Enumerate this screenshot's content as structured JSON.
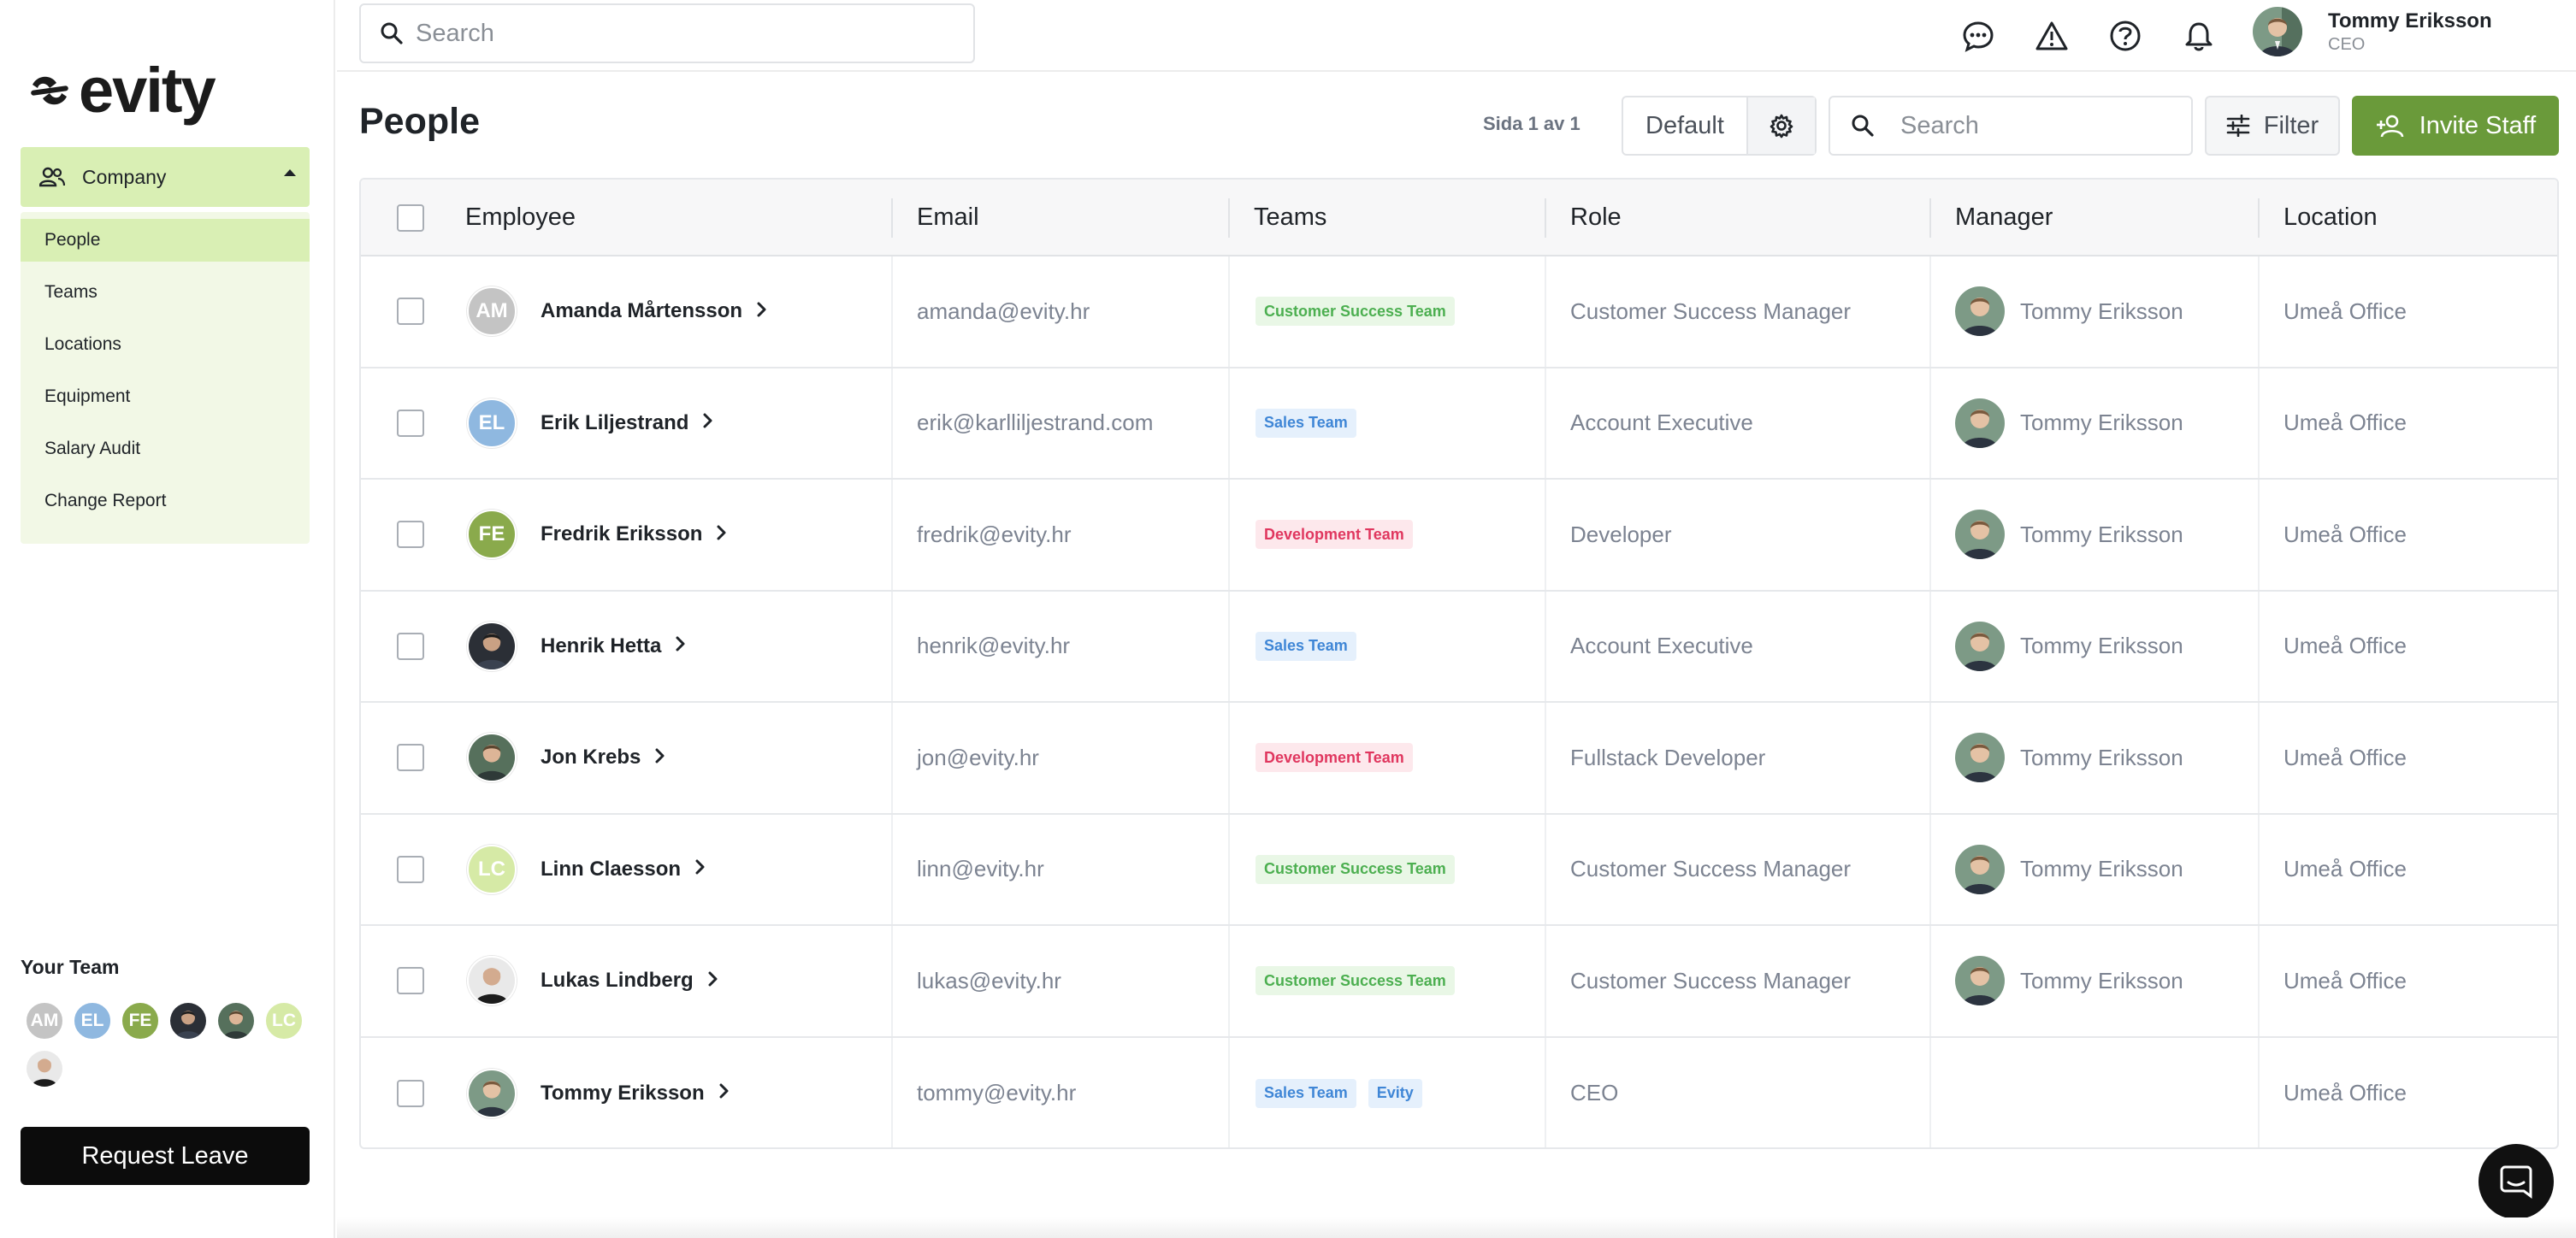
{
  "brand": {
    "logo_text": "evity",
    "accent": "#6a9a3a",
    "nav_active": "#d9efb4",
    "nav_bg": "#f2f8e6"
  },
  "topbar": {
    "search_placeholder": "Search",
    "icons": [
      "chat-icon",
      "alert-icon",
      "help-icon",
      "bell-icon"
    ],
    "user": {
      "name": "Tommy Eriksson",
      "role": "CEO"
    }
  },
  "sidebar": {
    "section_label": "Company",
    "items": [
      {
        "label": "People",
        "active": true
      },
      {
        "label": "Teams"
      },
      {
        "label": "Locations"
      },
      {
        "label": "Equipment"
      },
      {
        "label": "Salary Audit"
      },
      {
        "label": "Change Report"
      }
    ],
    "your_team_label": "Your Team",
    "team_members": [
      {
        "initials": "AM",
        "color": "#c4c4c4"
      },
      {
        "initials": "EL",
        "color": "#8fb8e0"
      },
      {
        "initials": "FE",
        "color": "#8aaa4c"
      },
      {
        "initials": "",
        "photo": "dark"
      },
      {
        "initials": "",
        "photo": "green"
      },
      {
        "initials": "LC",
        "color": "#d6eaa6"
      },
      {
        "initials": "",
        "photo": "bald"
      }
    ],
    "request_leave_label": "Request Leave"
  },
  "page": {
    "title": "People",
    "pager": "Sida 1 av 1",
    "view_label": "Default",
    "search_placeholder": "Search",
    "filter_label": "Filter",
    "invite_label": "Invite Staff"
  },
  "table": {
    "columns": [
      "Employee",
      "Email",
      "Teams",
      "Role",
      "Manager",
      "Location"
    ],
    "rows": [
      {
        "initials": "AM",
        "avatar_color": "#c4c4c4",
        "name": "Amanda Mårtensson",
        "email": "amanda@evity.hr",
        "teams": [
          {
            "label": "Customer Success Team",
            "kind": "green"
          }
        ],
        "role": "Customer Success Manager",
        "manager": "Tommy Eriksson",
        "location": "Umeå Office"
      },
      {
        "initials": "EL",
        "avatar_color": "#8fb8e0",
        "name": "Erik Liljestrand",
        "email": "erik@karlliljestrand.com",
        "teams": [
          {
            "label": "Sales Team",
            "kind": "blue"
          }
        ],
        "role": "Account Executive",
        "manager": "Tommy Eriksson",
        "location": "Umeå Office"
      },
      {
        "initials": "FE",
        "avatar_color": "#8aaa4c",
        "name": "Fredrik Eriksson",
        "email": "fredrik@evity.hr",
        "teams": [
          {
            "label": "Development Team",
            "kind": "red"
          }
        ],
        "role": "Developer",
        "manager": "Tommy Eriksson",
        "location": "Umeå Office"
      },
      {
        "initials": "",
        "photo": "dark",
        "name": "Henrik Hetta",
        "email": "henrik@evity.hr",
        "teams": [
          {
            "label": "Sales Team",
            "kind": "blue"
          }
        ],
        "role": "Account Executive",
        "manager": "Tommy Eriksson",
        "location": "Umeå Office"
      },
      {
        "initials": "",
        "photo": "green",
        "name": "Jon Krebs",
        "email": "jon@evity.hr",
        "teams": [
          {
            "label": "Development Team",
            "kind": "red"
          }
        ],
        "role": "Fullstack Developer",
        "manager": "Tommy Eriksson",
        "location": "Umeå Office"
      },
      {
        "initials": "LC",
        "avatar_color": "#d6eaa6",
        "name": "Linn Claesson",
        "email": "linn@evity.hr",
        "teams": [
          {
            "label": "Customer Success Team",
            "kind": "green"
          }
        ],
        "role": "Customer Success Manager",
        "manager": "Tommy Eriksson",
        "location": "Umeå Office"
      },
      {
        "initials": "",
        "photo": "bald",
        "name": "Lukas Lindberg",
        "email": "lukas@evity.hr",
        "teams": [
          {
            "label": "Customer Success Team",
            "kind": "green"
          }
        ],
        "role": "Customer Success Manager",
        "manager": "Tommy Eriksson",
        "location": "Umeå Office"
      },
      {
        "initials": "",
        "photo": "tommy",
        "name": "Tommy Eriksson",
        "email": "tommy@evity.hr",
        "teams": [
          {
            "label": "Sales Team",
            "kind": "blue"
          },
          {
            "label": "Evity",
            "kind": "blue"
          }
        ],
        "role": "CEO",
        "manager": "",
        "location": "Umeå Office"
      }
    ],
    "badge_colors": {
      "green": {
        "bg": "#e9f7e6",
        "fg": "#4caf50"
      },
      "blue": {
        "bg": "#e5f0fc",
        "fg": "#3f86d6"
      },
      "red": {
        "bg": "#fde8ec",
        "fg": "#e0375f"
      }
    }
  }
}
